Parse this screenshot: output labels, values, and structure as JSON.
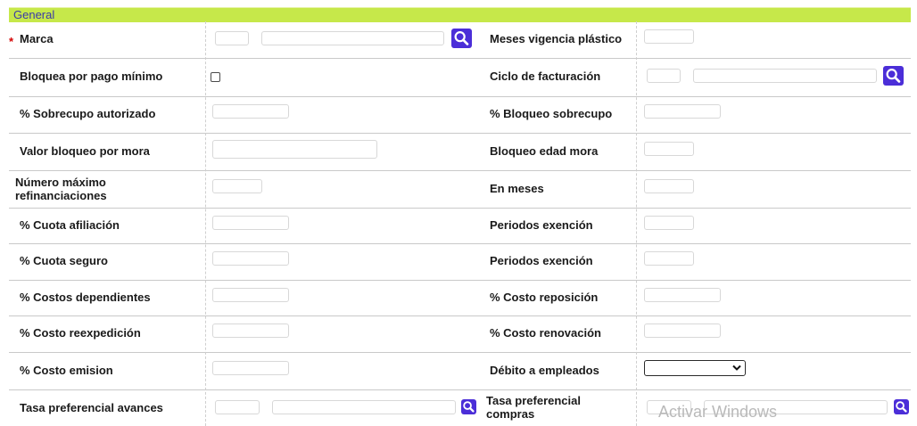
{
  "section": {
    "title": "General"
  },
  "required_mark": "*",
  "labels": {
    "marca": "Marca",
    "meses_vigencia": "Meses vigencia plástico",
    "bloquea_pago": "Bloquea por pago mínimo",
    "ciclo_facturacion": "Ciclo de facturación",
    "sobrecupo_autorizado": "% Sobrecupo autorizado",
    "bloqueo_sobrecupo": "% Bloqueo sobrecupo",
    "valor_bloqueo_mora": "Valor bloqueo por mora",
    "bloqueo_edad_mora": "Bloqueo edad mora",
    "numero_max_refin": "Número máximo refinanciaciones",
    "en_meses": "En meses",
    "cuota_afiliacion": "% Cuota afiliación",
    "periodos_exencion_1": "Periodos exención",
    "cuota_seguro": "% Cuota seguro",
    "periodos_exencion_2": "Periodos exención",
    "costos_dependientes": "% Costos dependientes",
    "costo_reposicion": "% Costo reposición",
    "costo_reexpedicion": "% Costo reexpedición",
    "costo_renovacion": "% Costo renovación",
    "costo_emision": "% Costo emision",
    "debito_empleados": "Débito a empleados",
    "tasa_pref_avances": "Tasa preferencial avances",
    "tasa_pref_compras": "Tasa preferencial compras"
  },
  "fields": {
    "marca_code": "",
    "marca_name": "",
    "meses_vigencia": "",
    "bloquea_pago_checked": false,
    "ciclo_code": "",
    "ciclo_name": "",
    "sobrecupo_autorizado": "",
    "bloqueo_sobrecupo": "",
    "valor_bloqueo_mora": "",
    "bloqueo_edad_mora": "",
    "numero_max_refin": "",
    "en_meses": "",
    "cuota_afiliacion": "",
    "periodos_exencion_1": "",
    "cuota_seguro": "",
    "periodos_exencion_2": "",
    "costos_dependientes": "",
    "costo_reposicion": "",
    "costo_reexpedicion": "",
    "costo_renovacion": "",
    "costo_emision": "",
    "debito_empleados": "",
    "tasa_avances_code": "",
    "tasa_avances_name": "",
    "tasa_compras_code": "",
    "tasa_compras_name": ""
  },
  "icons": {
    "search": "search-icon",
    "dropdown": "chevron-down-icon"
  },
  "colors": {
    "header_bg": "#c6e84a",
    "header_text": "#3a3aa8",
    "search_button": "#4b2ed8",
    "required": "#d40000"
  },
  "watermark": "Activar Windows"
}
